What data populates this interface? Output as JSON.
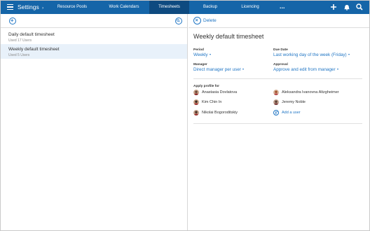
{
  "nav": {
    "settings_label": "Settings",
    "tabs": [
      {
        "label": "Resource Pools"
      },
      {
        "label": "Work Calendars"
      },
      {
        "label": "Timesheets",
        "active": true
      },
      {
        "label": "Backup"
      },
      {
        "label": "Licencing"
      }
    ],
    "more_label": "..."
  },
  "timesheets": [
    {
      "name": "Daily default timesheet",
      "usage": "Used 17 Users"
    },
    {
      "name": "Weekly default timesheet",
      "usage": "Used 5 Users",
      "selected": true
    }
  ],
  "detail": {
    "delete_label": "Delete",
    "title": "Weekly default timesheet",
    "fields": {
      "period": {
        "label": "Period",
        "value": "Weekly"
      },
      "due_date": {
        "label": "Due Date",
        "value": "Last working day of the week (Friday)"
      },
      "manager": {
        "label": "Manager",
        "value": "Direct manager per user"
      },
      "approval": {
        "label": "Approval",
        "value": "Approve and edit from manager"
      }
    },
    "apply_label": "Apply profile for",
    "people": [
      {
        "name": "Anastasia Dovlatova"
      },
      {
        "name": "Aleksandra Ivanovna Altzgheimer"
      },
      {
        "name": "Kim Chin In"
      },
      {
        "name": "Jeremy Noble"
      },
      {
        "name": "Nikolai Bogoroditskiy"
      }
    ],
    "add_user_label": "Add a user"
  },
  "colors": {
    "nav_bg": "#1565a8",
    "nav_active": "#0e4a80",
    "accent": "#1f75c4",
    "selected_row": "#e8f1fa"
  }
}
